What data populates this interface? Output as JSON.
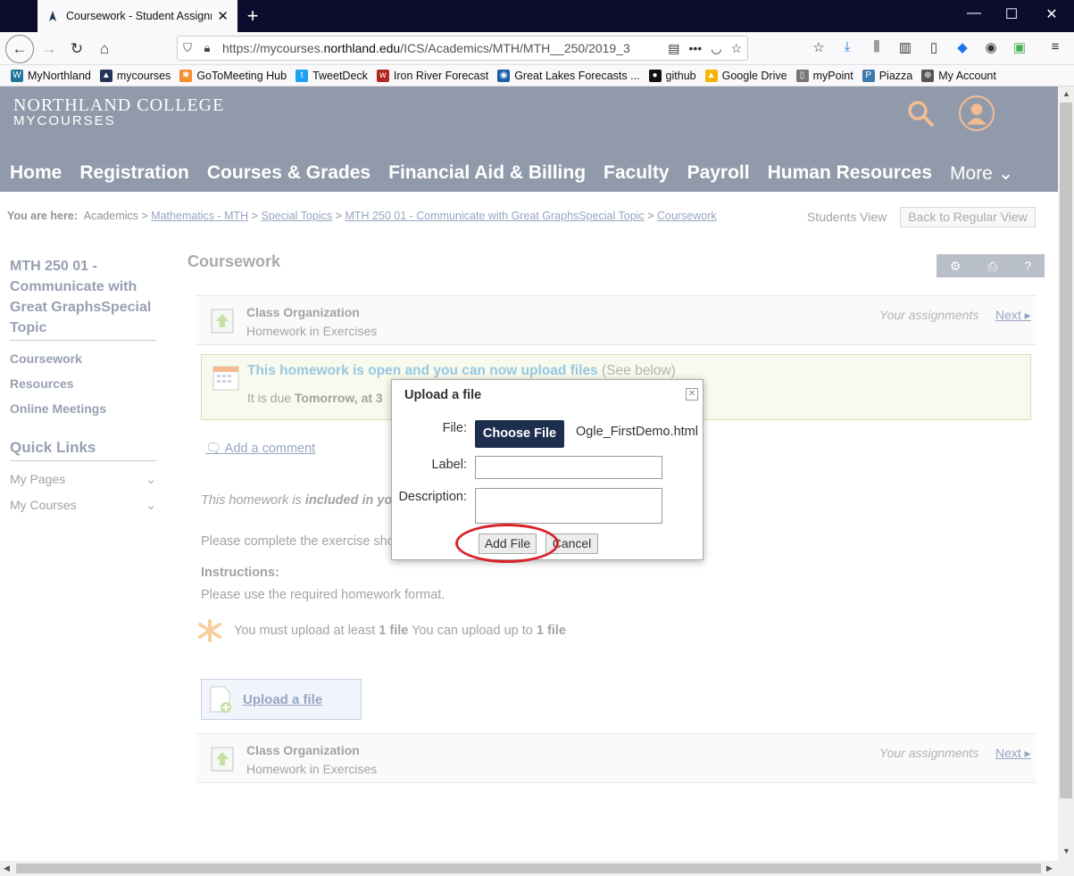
{
  "browser": {
    "tab_title": "Coursework - Student Assignm",
    "url_prefix": "https://mycourses.",
    "url_domain": "northland.edu",
    "url_path": "/ICS/Academics/MTH/MTH__250/2019_3",
    "bookmarks": [
      {
        "label": "MyNorthland",
        "icon": "wordpress-icon",
        "color": "#21759b"
      },
      {
        "label": "mycourses",
        "icon": "northland-icon",
        "color": "#233554"
      },
      {
        "label": "GoToMeeting Hub",
        "icon": "gotomeeting-icon",
        "color": "#f68d2e"
      },
      {
        "label": "TweetDeck",
        "icon": "twitter-icon",
        "color": "#1da1f2"
      },
      {
        "label": "Iron River Forecast",
        "icon": "forecast-icon",
        "color": "#b0281f"
      },
      {
        "label": "Great Lakes Forecasts ...",
        "icon": "noaa-icon",
        "color": "#1a5fa8"
      },
      {
        "label": "github",
        "icon": "github-icon",
        "color": "#111"
      },
      {
        "label": "Google Drive",
        "icon": "drive-icon",
        "color": "#f4b400"
      },
      {
        "label": "myPoint",
        "icon": "page-icon",
        "color": "#777"
      },
      {
        "label": "Piazza",
        "icon": "piazza-icon",
        "color": "#3e7aab"
      },
      {
        "label": "My Account",
        "icon": "globe-icon",
        "color": "#555"
      }
    ]
  },
  "site": {
    "logo_line1": "NORTHLAND COLLEGE",
    "logo_line2": "MYCOURSES",
    "nav": [
      "Home",
      "Registration",
      "Courses & Grades",
      "Financial Aid & Billing",
      "Faculty",
      "Payroll",
      "Human Resources"
    ],
    "nav_more": "More ⌄",
    "accent": "#e87722",
    "header_bg": "#233554"
  },
  "breadcrumb": {
    "label": "You are here:",
    "items": [
      "Academics",
      "Mathematics - MTH",
      "Special Topics",
      "MTH 250 01 - Communicate with Great GraphsSpecial Topic",
      "Coursework"
    ],
    "separator": " > ",
    "students_view": "Students View",
    "back_button": "Back to Regular View"
  },
  "sidebar": {
    "course_title": "MTH 250 01 - Communicate with Great GraphsSpecial Topic",
    "links": [
      "Coursework",
      "Resources",
      "Online Meetings"
    ],
    "quick_links_title": "Quick Links",
    "quick_links": [
      "My Pages",
      "My Courses"
    ]
  },
  "main": {
    "title": "Coursework",
    "assignment": {
      "title": "Class Organization",
      "subtitle": "Homework in Exercises",
      "your_assignments": "Your assignments",
      "next": "Next"
    },
    "open_notice": {
      "title": "This homework is open and you can now upload files",
      "see_below": "(See below)",
      "due_prefix": "It is due ",
      "due_value": "Tomorrow, at 3"
    },
    "add_comment": "Add a comment",
    "included_prefix": "This homework is ",
    "included_bold": "included in yo",
    "complete_text": "Please complete the exercise sho",
    "instructions_label": "Instructions:",
    "instructions_text": "Please use the required homework format.",
    "upload_requirement": {
      "part1": "You must upload at least ",
      "bold1": "1 file",
      "part2": " You can upload up to ",
      "bold2": "1 file"
    },
    "upload_button": "Upload a file"
  },
  "dialog": {
    "title": "Upload a file",
    "file_label": "File:",
    "choose_button": "Choose File",
    "file_name": "Ogle_FirstDemo.html",
    "label_label": "Label:",
    "label_value": "",
    "description_label": "Description:",
    "description_value": "",
    "add_button": "Add File",
    "cancel_button": "Cancel",
    "highlight_color": "#d8232a"
  }
}
